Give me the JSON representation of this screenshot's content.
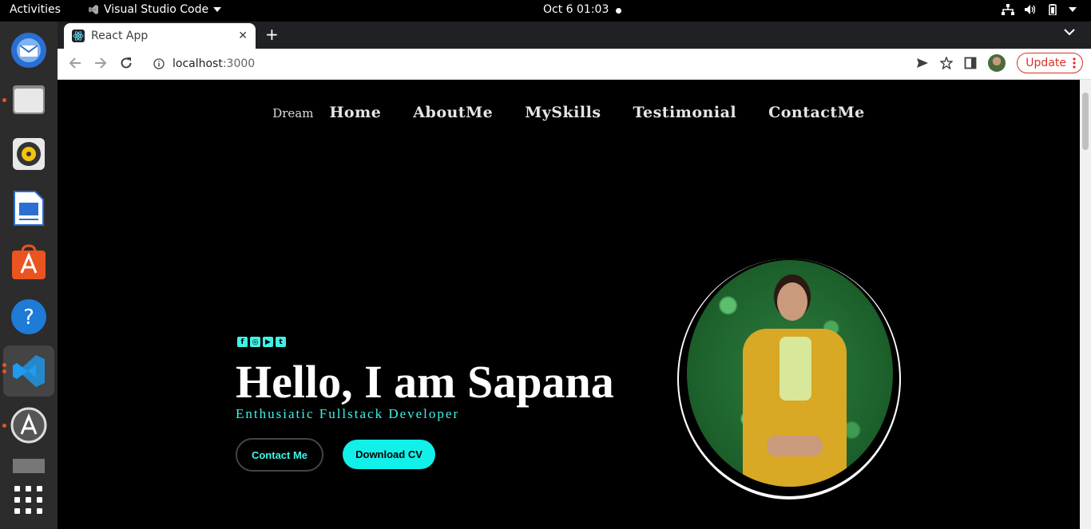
{
  "system": {
    "activities": "Activities",
    "app_name": "Visual Studio Code",
    "clock": "Oct 6  01:03"
  },
  "browser": {
    "tab_title": "React App",
    "url_host": "localhost",
    "url_port": ":3000",
    "update_label": "Update"
  },
  "site": {
    "brand": "Dream",
    "nav": [
      "Home",
      "AboutMe",
      "MySkills",
      "Testimonial",
      "ContactMe"
    ],
    "hero_title": "Hello, I am Sapana",
    "hero_subtitle": "Enthusiatic Fullstack Developer",
    "contact_button": "Contact Me",
    "download_button": "Download CV",
    "socials": [
      "facebook-icon",
      "instagram-icon",
      "youtube-icon",
      "twitter-icon"
    ]
  },
  "colors": {
    "accent": "#12f0ea",
    "page_bg": "#000000",
    "update_red": "#d93025",
    "dock_bg": "#2c2c2c"
  }
}
